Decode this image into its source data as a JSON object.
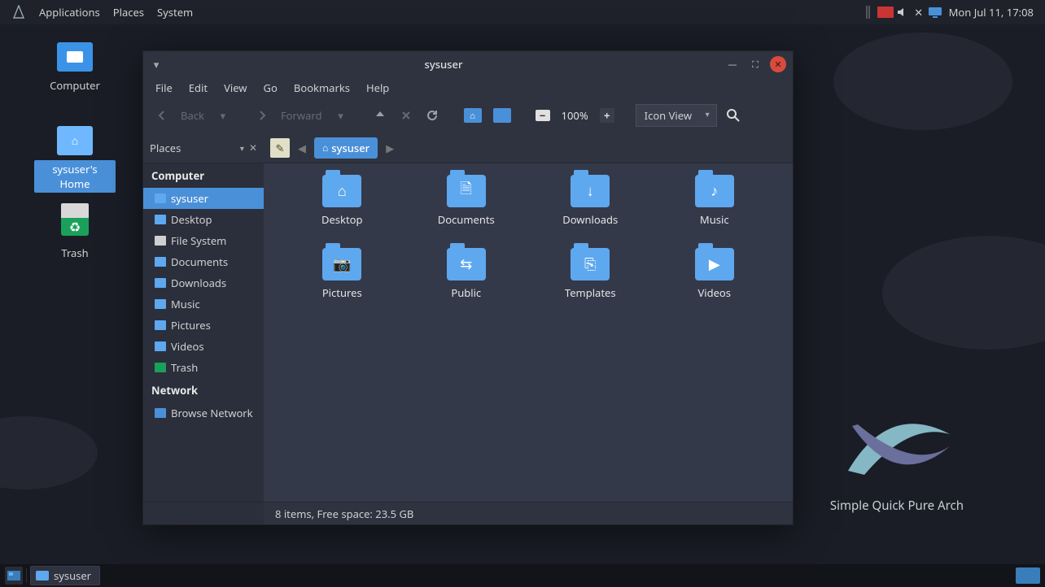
{
  "top_panel": {
    "menus": [
      "Applications",
      "Places",
      "System"
    ],
    "clock": "Mon Jul 11, 17:08",
    "tray_icons": [
      "separator-icon",
      "keyboard-layout-icon",
      "volume-muted-icon",
      "close-x-icon",
      "display-icon"
    ]
  },
  "desktop_icons": {
    "computer": "Computer",
    "home": "sysuser's Home",
    "trash": "Trash"
  },
  "brand_text": "Simple Quick Pure Arch",
  "fm": {
    "title": "sysuser",
    "menubar": [
      "File",
      "Edit",
      "View",
      "Go",
      "Bookmarks",
      "Help"
    ],
    "toolbar": {
      "back": "Back",
      "forward": "Forward",
      "zoom": "100%",
      "view_mode": "Icon View"
    },
    "sidepanel_label": "Places",
    "breadcrumb": "sysuser",
    "sidebar": {
      "computer_header": "Computer",
      "network_header": "Network",
      "items": [
        {
          "label": "sysuser",
          "icon": "#5ea8ef",
          "active": true
        },
        {
          "label": "Desktop",
          "icon": "#5ea8ef"
        },
        {
          "label": "File System",
          "icon": "#cfcfcf"
        },
        {
          "label": "Documents",
          "icon": "#5ea8ef"
        },
        {
          "label": "Downloads",
          "icon": "#5ea8ef"
        },
        {
          "label": "Music",
          "icon": "#5ea8ef"
        },
        {
          "label": "Pictures",
          "icon": "#5ea8ef"
        },
        {
          "label": "Videos",
          "icon": "#5ea8ef"
        },
        {
          "label": "Trash",
          "icon": "#1aa05a"
        }
      ],
      "network_items": [
        {
          "label": "Browse Network",
          "icon": "#4a90d9"
        }
      ]
    },
    "folders": [
      {
        "name": "Desktop",
        "glyph": "⌂"
      },
      {
        "name": "Documents",
        "glyph": "🗎"
      },
      {
        "name": "Downloads",
        "glyph": "↓"
      },
      {
        "name": "Music",
        "glyph": "♪"
      },
      {
        "name": "Pictures",
        "glyph": "📷"
      },
      {
        "name": "Public",
        "glyph": "⇆"
      },
      {
        "name": "Templates",
        "glyph": "⎘"
      },
      {
        "name": "Videos",
        "glyph": "▶"
      }
    ],
    "status": "8 items, Free space: 23.5 GB"
  },
  "bottom_panel": {
    "task_label": "sysuser"
  }
}
